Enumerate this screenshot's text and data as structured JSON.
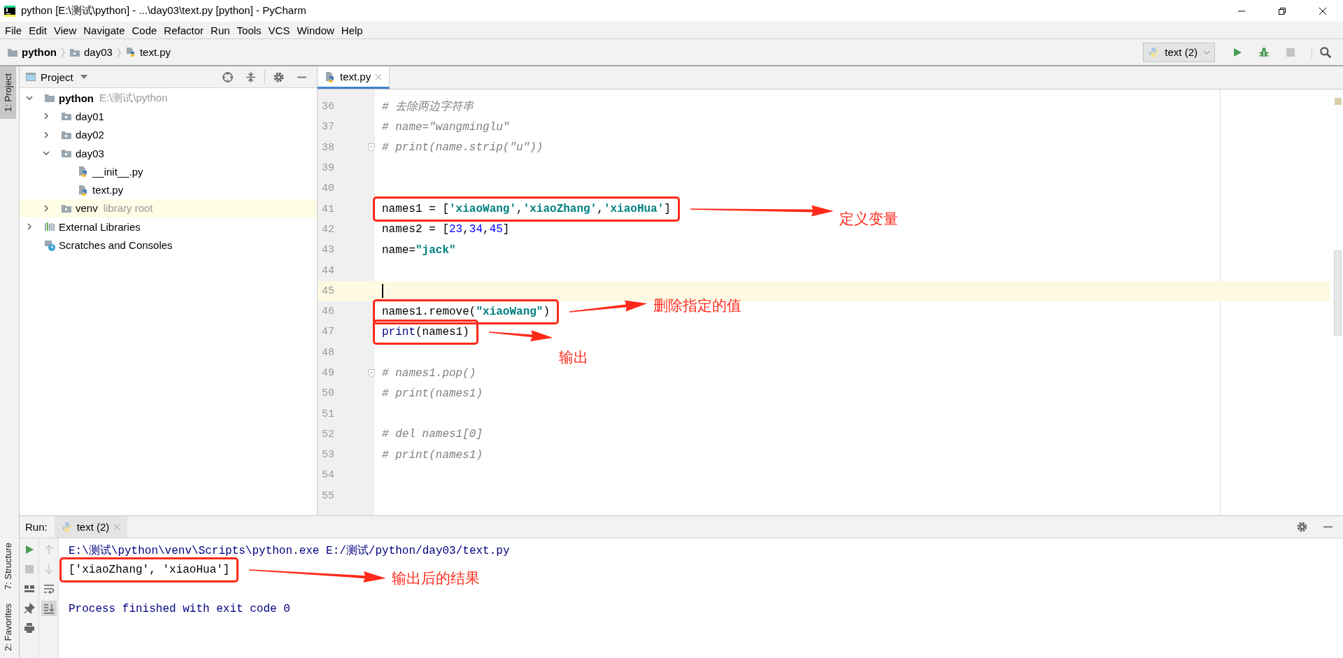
{
  "window": {
    "title": "python [E:\\测试\\python] - ...\\day03\\text.py [python] - PyCharm"
  },
  "menu": [
    "File",
    "Edit",
    "View",
    "Navigate",
    "Code",
    "Refactor",
    "Run",
    "Tools",
    "VCS",
    "Window",
    "Help"
  ],
  "breadcrumb": [
    {
      "label": "python",
      "kind": "project"
    },
    {
      "label": "day03",
      "kind": "folder"
    },
    {
      "label": "text.py",
      "kind": "python-file"
    }
  ],
  "run_config": {
    "label": "text (2)"
  },
  "toolbar": [
    {
      "kind": "run",
      "disabled": false
    },
    {
      "kind": "debug",
      "disabled": false
    },
    {
      "kind": "stop",
      "disabled": true
    },
    {
      "kind": "search",
      "disabled": false
    }
  ],
  "left_stripe_top": [
    {
      "label": "1: Project",
      "selected": true
    }
  ],
  "left_stripe_bottom": [
    {
      "label": "7: Structure",
      "selected": false
    },
    {
      "label": "2: Favorites",
      "selected": false
    }
  ],
  "project_panel": {
    "title": "Project",
    "tree": [
      {
        "label": "python",
        "hint": "E:\\测试\\python",
        "kind": "project",
        "expanded": true,
        "children": [
          {
            "label": "day01",
            "kind": "folder",
            "expanded": false
          },
          {
            "label": "day02",
            "kind": "folder",
            "expanded": false
          },
          {
            "label": "day03",
            "kind": "folder",
            "expanded": true,
            "children": [
              {
                "label": "__init__.py",
                "kind": "python-file"
              },
              {
                "label": "text.py",
                "kind": "python-file"
              }
            ]
          },
          {
            "label": "venv",
            "hint": "library root",
            "kind": "library-root",
            "expanded": false
          }
        ]
      },
      {
        "label": "External Libraries",
        "kind": "libraries",
        "expanded": false
      },
      {
        "label": "Scratches and Consoles",
        "kind": "scratches"
      }
    ]
  },
  "editor": {
    "tabs": [
      {
        "label": "text.py",
        "selected": true
      }
    ],
    "lines": [
      {
        "number": "36",
        "tokens": [
          {
            "text": "# 去除两边字符串",
            "kind": "comment"
          }
        ],
        "fold": false,
        "current": false,
        "boxed": false
      },
      {
        "number": "37",
        "tokens": [
          {
            "text": "# name=\"wangminglu\"",
            "kind": "comment"
          }
        ],
        "fold": false,
        "current": false,
        "boxed": false
      },
      {
        "number": "38",
        "tokens": [
          {
            "text": "# print(name.strip(\"u\"))",
            "kind": "comment"
          }
        ],
        "fold": true,
        "current": false,
        "boxed": false
      },
      {
        "number": "39",
        "fold": false,
        "current": false,
        "boxed": false
      },
      {
        "number": "40",
        "fold": false,
        "current": false,
        "boxed": false
      },
      {
        "number": "41",
        "tokens": [
          {
            "text": "names1 = [",
            "kind": "plain"
          },
          {
            "text": "'xiaoWang'",
            "kind": "string"
          },
          {
            "text": ",",
            "kind": "plain"
          },
          {
            "text": "'xiaoZhang'",
            "kind": "string"
          },
          {
            "text": ",",
            "kind": "plain"
          },
          {
            "text": "'xiaoHua'",
            "kind": "string"
          },
          {
            "text": "]",
            "kind": "plain"
          }
        ],
        "fold": false,
        "current": false,
        "boxed": true,
        "note": "定义变量"
      },
      {
        "number": "42",
        "tokens": [
          {
            "text": "names2 = [",
            "kind": "plain"
          },
          {
            "text": "23",
            "kind": "number"
          },
          {
            "text": ",",
            "kind": "plain"
          },
          {
            "text": "34",
            "kind": "number"
          },
          {
            "text": ",",
            "kind": "plain"
          },
          {
            "text": "45",
            "kind": "number"
          },
          {
            "text": "]",
            "kind": "plain"
          }
        ],
        "fold": false,
        "current": false,
        "boxed": false
      },
      {
        "number": "43",
        "tokens": [
          {
            "text": "name=",
            "kind": "plain"
          },
          {
            "text": "\"jack\"",
            "kind": "string"
          }
        ],
        "fold": false,
        "current": false,
        "boxed": false
      },
      {
        "number": "44",
        "fold": false,
        "current": false,
        "boxed": false
      },
      {
        "number": "45",
        "fold": false,
        "current": true,
        "boxed": false
      },
      {
        "number": "46",
        "tokens": [
          {
            "text": "names1.remove(",
            "kind": "plain"
          },
          {
            "text": "\"xiaoWang\"",
            "kind": "string"
          },
          {
            "text": ")",
            "kind": "plain"
          }
        ],
        "fold": false,
        "current": false,
        "boxed": true,
        "note": "删除指定的值"
      },
      {
        "number": "47",
        "tokens": [
          {
            "text": "print",
            "kind": "builtin"
          },
          {
            "text": "(names1)",
            "kind": "plain"
          }
        ],
        "fold": false,
        "current": false,
        "boxed": true,
        "note": "输出"
      },
      {
        "number": "48",
        "fold": false,
        "current": false,
        "boxed": false
      },
      {
        "number": "49",
        "tokens": [
          {
            "text": "# names1.pop()",
            "kind": "comment"
          }
        ],
        "fold": true,
        "current": false,
        "boxed": false
      },
      {
        "number": "50",
        "tokens": [
          {
            "text": "# print(names1)",
            "kind": "comment"
          }
        ],
        "fold": false,
        "current": false,
        "boxed": false
      },
      {
        "number": "51",
        "fold": false,
        "current": false,
        "boxed": false
      },
      {
        "number": "52",
        "tokens": [
          {
            "text": "# del names1[0]",
            "kind": "comment"
          }
        ],
        "fold": false,
        "current": false,
        "boxed": false
      },
      {
        "number": "53",
        "tokens": [
          {
            "text": "# print(names1)",
            "kind": "comment"
          }
        ],
        "fold": false,
        "current": false,
        "boxed": false
      },
      {
        "number": "54",
        "fold": false,
        "current": false,
        "boxed": false
      },
      {
        "number": "55",
        "fold": false,
        "current": false,
        "boxed": false
      }
    ]
  },
  "run_panel": {
    "label": "Run:",
    "tabs": [
      {
        "label": "text (2)",
        "selected": true
      }
    ],
    "side_tools": [
      {
        "kind": "rerun",
        "disabled": false,
        "selected": false
      },
      {
        "kind": "up",
        "disabled": true,
        "selected": false
      },
      {
        "kind": "stop",
        "disabled": true,
        "selected": false
      },
      {
        "kind": "down",
        "disabled": true,
        "selected": false
      },
      {
        "kind": "layout",
        "disabled": false,
        "selected": false
      },
      {
        "kind": "wrap",
        "disabled": false,
        "selected": false
      },
      {
        "kind": "pin",
        "disabled": false,
        "selected": false
      },
      {
        "kind": "scroll-end",
        "disabled": false,
        "selected": true
      },
      {
        "kind": "print",
        "disabled": false,
        "selected": false
      }
    ],
    "console": [
      {
        "text": "E:\\测试\\python\\venv\\Scripts\\python.exe E:/测试/python/day03/text.py",
        "kind": "system",
        "boxed": false
      },
      {
        "text": "['xiaoZhang', 'xiaoHua']",
        "kind": "output",
        "boxed": true,
        "note": "输出后的结果"
      },
      {
        "text": "Process finished with exit code 0",
        "kind": "status",
        "boxed": false
      }
    ]
  }
}
